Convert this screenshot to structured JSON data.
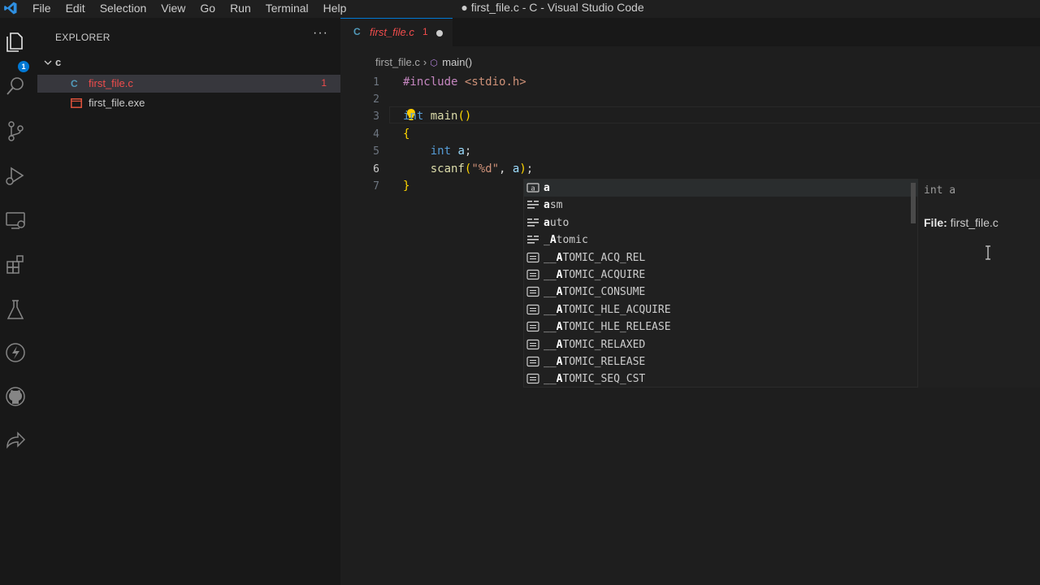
{
  "window": {
    "title": "● first_file.c - C - Visual Studio Code",
    "menu": [
      "File",
      "Edit",
      "Selection",
      "View",
      "Go",
      "Run",
      "Terminal",
      "Help"
    ]
  },
  "activity_bar": {
    "items": [
      "explorer-icon",
      "search-icon",
      "source-control-icon",
      "run-debug-icon",
      "remote-explorer-icon",
      "extensions-icon",
      "testing-icon",
      "lightning-icon",
      "github-icon",
      "live-share-icon"
    ],
    "explorer_badge": "1"
  },
  "sidebar": {
    "title": "EXPLORER",
    "more": "···",
    "folder": "c",
    "files": [
      {
        "icon": "C",
        "name": "first_file.c",
        "count": "1",
        "color": "#f14c4c"
      },
      {
        "icon": "exe",
        "name": "first_file.exe",
        "count": "",
        "color": "#cccccc"
      }
    ]
  },
  "editor": {
    "tab": {
      "icon": "C",
      "name": "first_file.c",
      "count": "1"
    },
    "breadcrumb": {
      "file": "first_file.c",
      "symbol": "main()"
    },
    "line_numbers": [
      "1",
      "2",
      "3",
      "4",
      "5",
      "6",
      "7"
    ],
    "lines": [
      "#include <stdio.h>",
      "",
      "int main()",
      "{",
      "    int a;",
      "    scanf(\"%d\", a);",
      "}"
    ]
  },
  "suggest": {
    "items": [
      {
        "icon": "variable",
        "label": "a"
      },
      {
        "icon": "keyword",
        "label": "asm"
      },
      {
        "icon": "keyword",
        "label": "auto"
      },
      {
        "icon": "keyword",
        "label": "_Atomic"
      },
      {
        "icon": "text",
        "label": "__ATOMIC_ACQ_REL"
      },
      {
        "icon": "text",
        "label": "__ATOMIC_ACQUIRE"
      },
      {
        "icon": "text",
        "label": "__ATOMIC_CONSUME"
      },
      {
        "icon": "text",
        "label": "__ATOMIC_HLE_ACQUIRE"
      },
      {
        "icon": "text",
        "label": "__ATOMIC_HLE_RELEASE"
      },
      {
        "icon": "text",
        "label": "__ATOMIC_RELAXED"
      },
      {
        "icon": "text",
        "label": "__ATOMIC_RELEASE"
      },
      {
        "icon": "text",
        "label": "__ATOMIC_SEQ_CST"
      }
    ],
    "details": {
      "type": "int a",
      "file_label": "File:",
      "file_name": "first_file.c"
    }
  }
}
